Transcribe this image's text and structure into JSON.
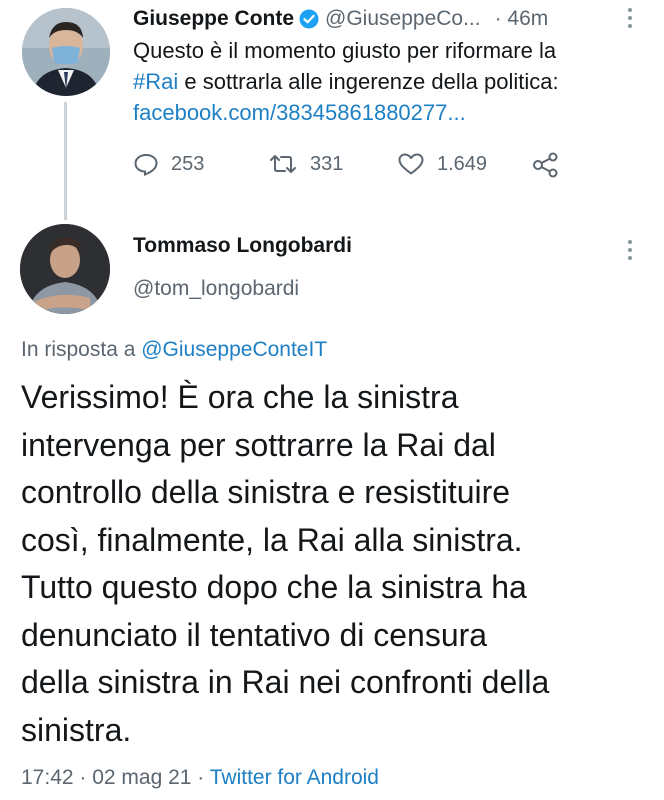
{
  "tweet": {
    "author_name": "Giuseppe Conte",
    "author_handle": "@GiuseppeCo...",
    "time": "· 46m",
    "text_line1": "Questo è il momento giusto per riformare la",
    "hashtag": "#Rai",
    "text_line2_rest": " e sottrarla alle ingerenze della politica:",
    "link": "facebook.com/38345861880277...",
    "replies": "253",
    "retweets": "331",
    "likes": "1.649",
    "icons": {
      "verified": "verified-badge-icon",
      "reply": "reply-icon",
      "retweet": "retweet-icon",
      "like": "heart-icon",
      "share": "share-icon"
    }
  },
  "reply": {
    "author_name": "Tommaso Longobardi",
    "author_handle": "@tom_longobardi",
    "in_reply_prefix": "In risposta a ",
    "in_reply_handle": "@GiuseppeConteIT",
    "lines": [
      "Verissimo! È ora che la sinistra",
      "intervenga per sottrarre la Rai dal",
      "controllo della sinistra e resistituire",
      "così, finalmente, la Rai alla sinistra.",
      "Tutto questo dopo che la sinistra ha",
      "denunciato il tentativo di censura",
      "della sinistra in Rai nei confronti della",
      "sinistra."
    ],
    "footer_time": "17:42 · 02 mag 21 · ",
    "footer_source": "Twitter for Android"
  },
  "colors": {
    "link": "#1d7fc4",
    "verified": "#1da1f2",
    "muted": "#5b6670",
    "thread_line": "#ccd3d8"
  }
}
